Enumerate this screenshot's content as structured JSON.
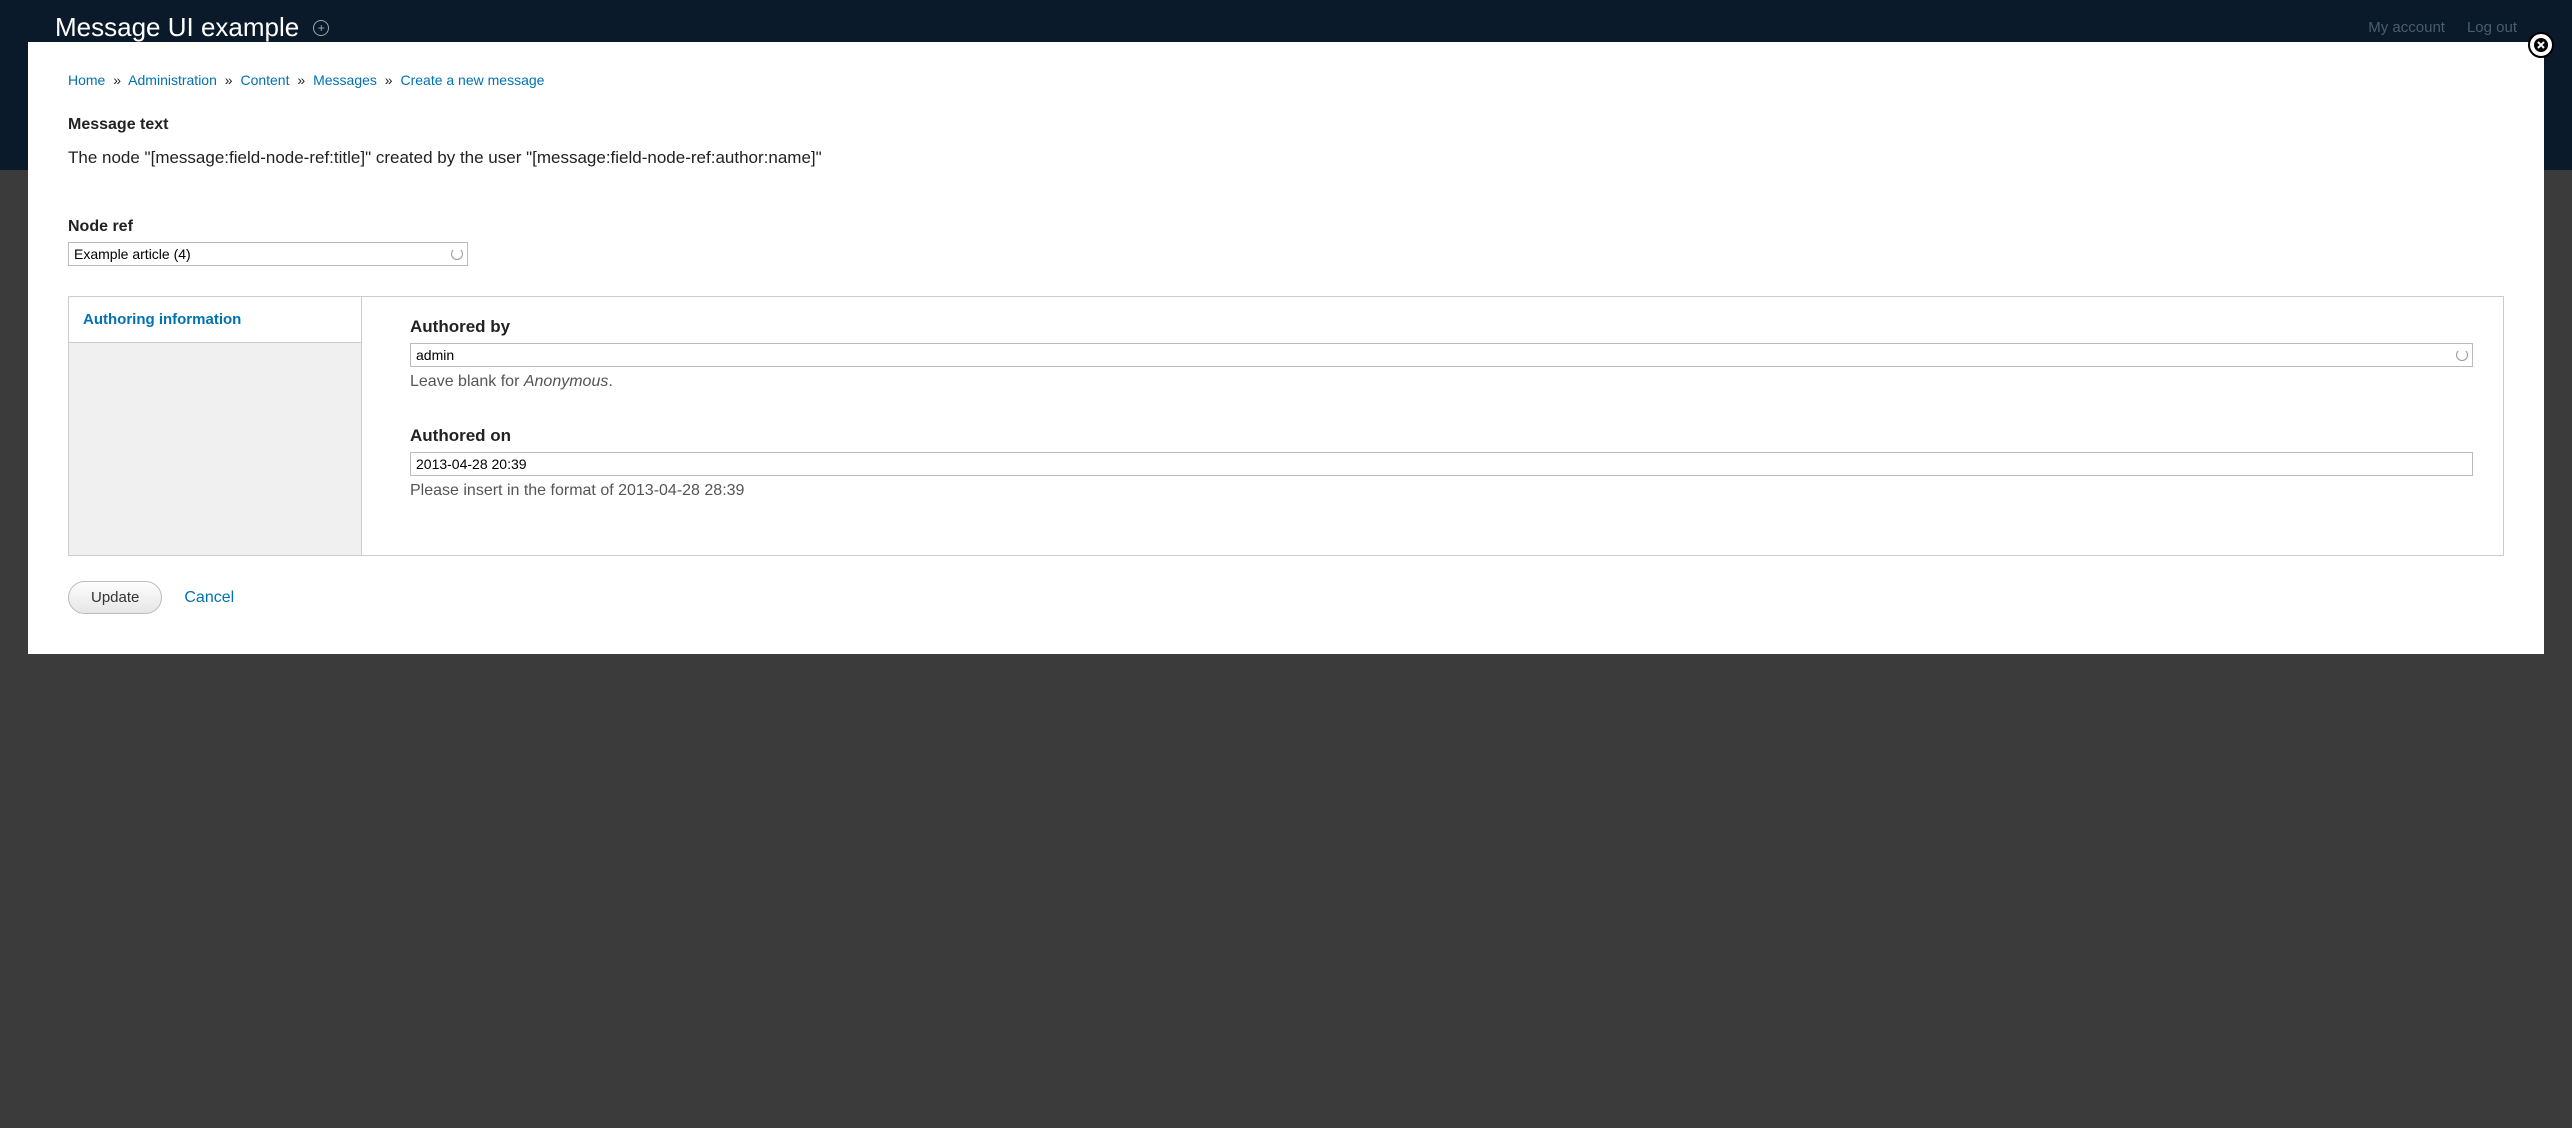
{
  "header": {
    "site_title": "Message UI example",
    "user_links": {
      "my_account": "My account",
      "log_out": "Log out"
    }
  },
  "breadcrumb": {
    "items": [
      "Home",
      "Administration",
      "Content",
      "Messages",
      "Create a new message"
    ],
    "sep": "»"
  },
  "message_text": {
    "label": "Message text",
    "body": "The node \"[message:field-node-ref:title]\" created by the user \"[message:field-node-ref:author:name]\""
  },
  "node_ref": {
    "label": "Node ref",
    "value": "Example article (4)"
  },
  "vertical_tabs": {
    "items": [
      {
        "label": "Authoring information"
      }
    ]
  },
  "authoring": {
    "authored_by": {
      "label": "Authored by",
      "value": "admin",
      "help_prefix": "Leave blank for ",
      "help_em": "Anonymous",
      "help_suffix": "."
    },
    "authored_on": {
      "label": "Authored on",
      "value": "2013-04-28 20:39",
      "help": "Please insert in the format of 2013-04-28 28:39"
    }
  },
  "actions": {
    "update": "Update",
    "cancel": "Cancel"
  }
}
